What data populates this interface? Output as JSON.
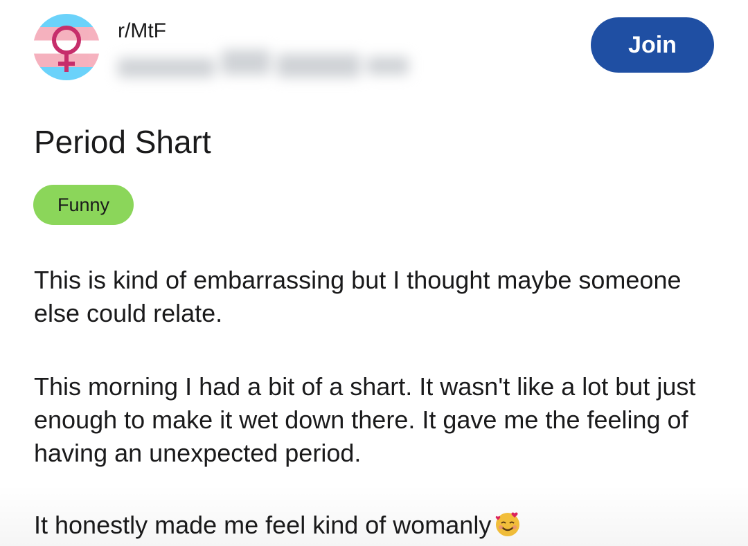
{
  "post": {
    "subreddit": "r/MtF",
    "join_label": "Join",
    "title": "Period Shart",
    "flair": "Funny",
    "paragraphs": [
      "This is kind of embarrassing but I thought maybe someone else could relate.",
      "This morning I had a bit of a shart. It wasn't like a lot but just enough to make it wet down there. It gave me the feeling of having an unexpected period.",
      "It honestly made me feel kind of womanly"
    ],
    "emoji": "smiling-face-with-hearts-icon"
  },
  "icons": {
    "avatar": "transgender-flag-venus-icon"
  },
  "colors": {
    "join_button": "#1f4fa3",
    "flair_bg": "#8bd65a",
    "text": "#1a1a1b",
    "trans_blue": "#5bcefa",
    "trans_pink": "#f5a9b8"
  }
}
